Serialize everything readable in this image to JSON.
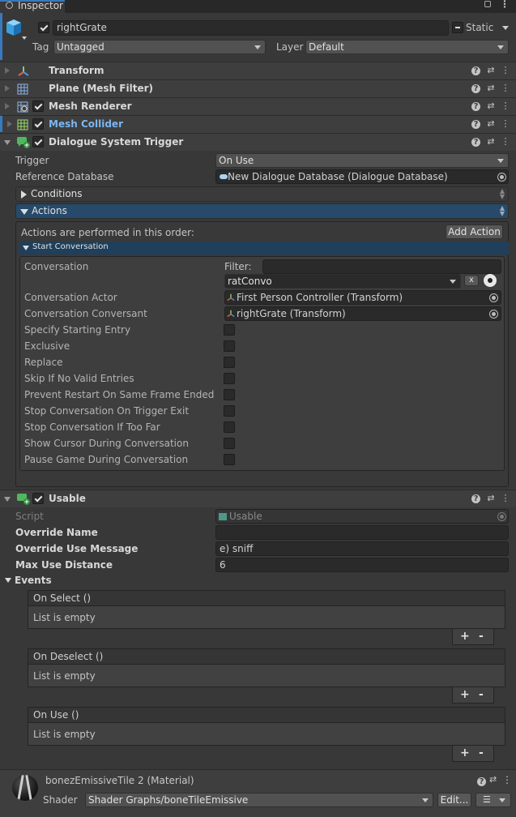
{
  "tab": {
    "label": "Inspector"
  },
  "header": {
    "name": "rightGrate",
    "static_label": "Static",
    "tag_label": "Tag",
    "tag_value": "Untagged",
    "layer_label": "Layer",
    "layer_value": "Default"
  },
  "components": {
    "transform": "Transform",
    "mesh_filter": "Plane (Mesh Filter)",
    "mesh_renderer": "Mesh Renderer",
    "mesh_collider": "Mesh Collider",
    "dst": "Dialogue System Trigger"
  },
  "dst": {
    "trigger_label": "Trigger",
    "trigger_value": "On Use",
    "refdb_label": "Reference Database",
    "refdb_value": "New Dialogue Database (Dialogue Database)",
    "conditions": "Conditions",
    "actions": "Actions",
    "actions_note": "Actions are performed in this order:",
    "add_action": "Add Action",
    "start_conv": "Start Conversation",
    "conversation_label": "Conversation",
    "filter_label": "Filter:",
    "filter_value": "",
    "conversation_value": "ratConvo",
    "x_btn": "x",
    "actor_label": "Conversation Actor",
    "actor_value": "First Person Controller (Transform)",
    "conversant_label": "Conversation Conversant",
    "conversant_value": "rightGrate (Transform)",
    "options": [
      "Specify Starting Entry",
      "Exclusive",
      "Replace",
      "Skip If No Valid Entries",
      "Prevent Restart On Same Frame Ended",
      "Stop Conversation On Trigger Exit",
      "Stop Conversation If Too Far",
      "Show Cursor During Conversation",
      "Pause Game During Conversation"
    ]
  },
  "usable": {
    "title": "Usable",
    "script_label": "Script",
    "script_value": "Usable",
    "override_name_label": "Override Name",
    "override_name_value": "",
    "override_msg_label": "Override Use Message",
    "override_msg_value": "e) sniff",
    "max_dist_label": "Max Use Distance",
    "max_dist_value": "6",
    "events_label": "Events",
    "events": [
      {
        "name": "On Select ()",
        "body": "List is empty"
      },
      {
        "name": "On Deselect ()",
        "body": "List is empty"
      },
      {
        "name": "On Use ()",
        "body": "List is empty"
      }
    ],
    "plus": "+",
    "minus": "-"
  },
  "material": {
    "name": "bonezEmissiveTile 2 (Material)",
    "shader_label": "Shader",
    "shader_value": "Shader Graphs/boneTileEmissive",
    "edit": "Edit..."
  }
}
